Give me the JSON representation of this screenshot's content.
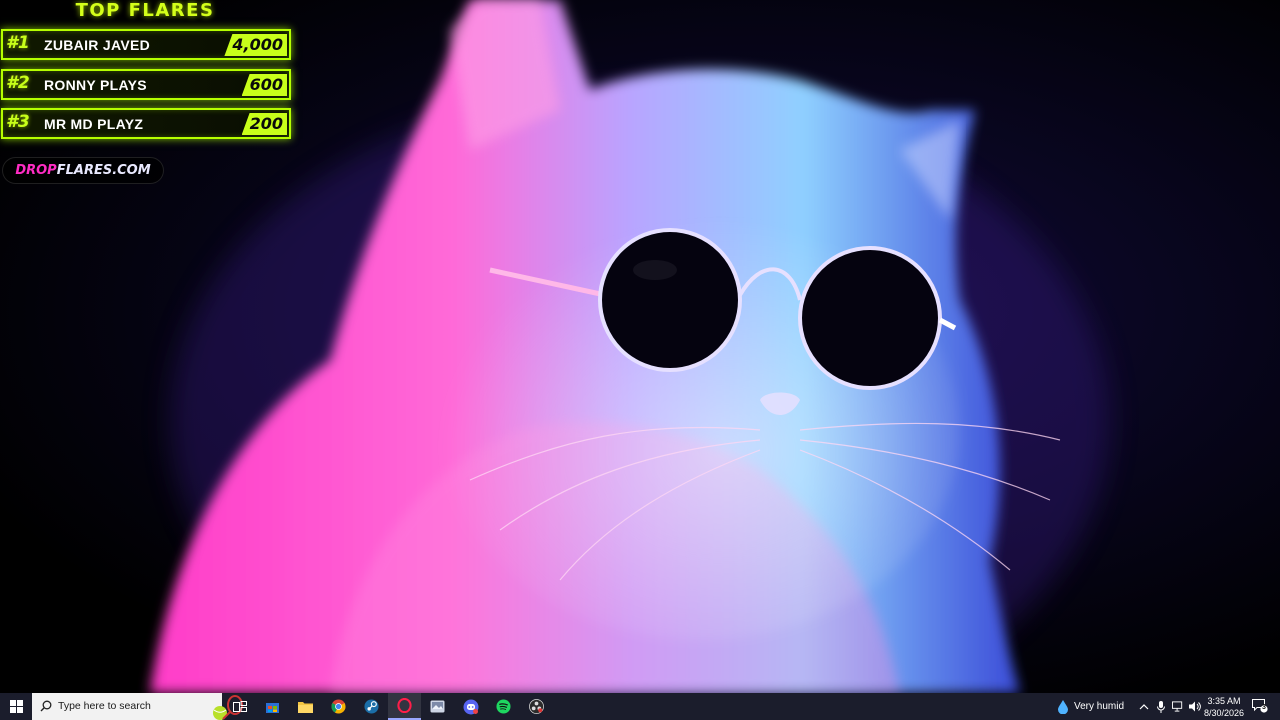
{
  "overlay": {
    "title": "TOP FLARES",
    "flares": [
      {
        "rank": "#1",
        "name": "ZUBAIR JAVED",
        "score": "4,000"
      },
      {
        "rank": "#2",
        "name": "RONNY PLAYS",
        "score": "600"
      },
      {
        "rank": "#3",
        "name": "MR MD PLAYZ",
        "score": "200"
      }
    ],
    "domain_part1": "DROP",
    "domain_part2": "FLARES.COM",
    "accent_color": "#c8ff1a",
    "brand_color": "#ff2cc4"
  },
  "taskbar": {
    "search_placeholder": "Type here to search",
    "pinned_apps": [
      "task-view",
      "microsoft-store",
      "file-explorer",
      "chrome",
      "steam",
      "opera-gx",
      "pictures-app",
      "discord",
      "spotify",
      "obs-studio"
    ],
    "weather": "Very humid",
    "time": "3:35 AM",
    "date": "8/30/2026",
    "notification_count": "3"
  }
}
